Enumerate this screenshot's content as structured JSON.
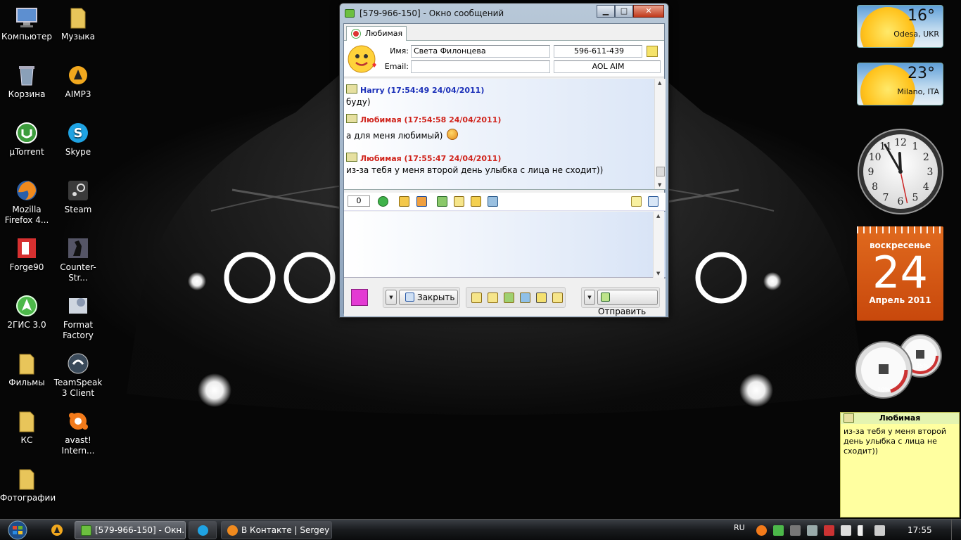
{
  "desktop": {
    "icons": [
      {
        "label": "Компьютер"
      },
      {
        "label": "Музыка"
      },
      {
        "label": "Корзина"
      },
      {
        "label": "AIMP3"
      },
      {
        "label": "µTorrent"
      },
      {
        "label": "Skype"
      },
      {
        "label": "Mozilla Firefox 4..."
      },
      {
        "label": "Steam"
      },
      {
        "label": "Forge90"
      },
      {
        "label": "Counter-Str..."
      },
      {
        "label": "2ГИС 3.0"
      },
      {
        "label": "Format Factory"
      },
      {
        "label": "Фильмы"
      },
      {
        "label": "TeamSpeak 3 Client"
      },
      {
        "label": "КС"
      },
      {
        "label": "avast! Intern..."
      },
      {
        "label": "Фотографии"
      }
    ]
  },
  "message_window": {
    "title": "[579-966-150] - Окно сообщений",
    "controls": {
      "minimize": "▁",
      "maximize": "□",
      "close": "✕"
    },
    "tab_label": "Любимая",
    "contact": {
      "name_label": "Имя:",
      "name_value": "Света  Филонцева",
      "email_label": "Email:",
      "email_value": "",
      "uin": "596-611-439",
      "protocol": "AOL AIM"
    },
    "history": [
      {
        "author": "Harry (17:54:49 24/04/2011)",
        "text": "буду)",
        "color": "#1a2fb8"
      },
      {
        "author": "Любимая (17:54:58 24/04/2011)",
        "text": "а для меня любимый)",
        "color": "#d0241c"
      },
      {
        "author": "Любимая (17:55:47 24/04/2011)",
        "text": "из-за тебя у меня второй день улыбка с лица не сходит))",
        "color": "#d0241c"
      }
    ],
    "char_counter": "0",
    "input_value": "",
    "close_button": "Закрыть",
    "send_button": "Отправить"
  },
  "gadgets": {
    "weather": [
      {
        "temp": "16°",
        "city": "Odesa, UKR"
      },
      {
        "temp": "23°",
        "city": "Milano, ITA"
      }
    ],
    "clock": {
      "hour": 11,
      "minute": 55,
      "second": 28
    },
    "calendar": {
      "weekday": "воскресенье",
      "day": "24",
      "month_year": "Апрель 2011"
    },
    "meters": {
      "cpu": "10%",
      "ram": "35%"
    },
    "note": {
      "title": "Любимая",
      "text": "из-за тебя у меня второй день улыбка с лица не сходит))"
    }
  },
  "taskbar": {
    "buttons": [
      {
        "label": "[579-966-150] - Окн..."
      },
      {
        "label": "В Контакте | Sergey ..."
      }
    ],
    "language": "RU",
    "time": "17:55"
  },
  "colors": {
    "calendar": "#d9581a",
    "note_bg": "#ffffa0",
    "author_blue": "#1a2fb8",
    "author_red": "#d0241c"
  }
}
